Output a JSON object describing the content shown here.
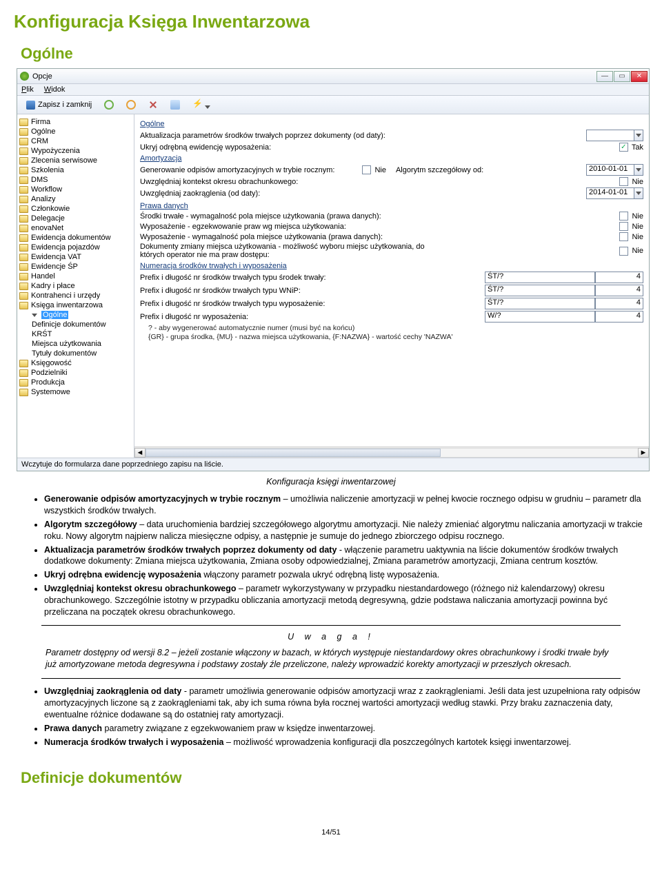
{
  "headings": {
    "h1": "Konfiguracja Księga Inwentarzowa",
    "h2": "Ogólne",
    "h3": "Definicje dokumentów"
  },
  "window": {
    "title": "Opcje",
    "menu_plik": "Plik",
    "menu_widok": "Widok",
    "save_close": "Zapisz i zamknij",
    "status": "Wczytuje do formularza dane poprzedniego zapisu na liście."
  },
  "tree": [
    "Firma",
    "Ogólne",
    "CRM",
    "Wypożyczenia",
    "Zlecenia serwisowe",
    "Szkolenia",
    "DMS",
    "Workflow",
    "Analizy",
    "Członkowie",
    "Delegacje",
    "enovaNet",
    "Ewidencja dokumentów",
    "Ewidencja pojazdów",
    "Ewidencja VAT",
    "Ewidencje ŚP",
    "Handel",
    "Kadry i płace",
    "Kontrahenci i urzędy",
    "Księga inwentarzowa"
  ],
  "tree_children": [
    "Ogólne",
    "Definicje dokumentów",
    "KRŚT",
    "Miejsca użytkowania",
    "Tytuły dokumentów"
  ],
  "tree_after": [
    "Księgowość",
    "Podzielniki",
    "Produkcja",
    "Systemowe"
  ],
  "form": {
    "sect_ogolne": "Ogólne",
    "r_upd": "Aktualizacja parametrów środków trwałych poprzez dokumenty (od daty):",
    "r_hide": "Ukryj odrębną ewidencję wyposażenia:",
    "r_hide_val": "Tak",
    "sect_amort": "Amortyzacja",
    "r_gen": "Generowanie odpisów amortyzacyjnych w trybie rocznym:",
    "r_gen_val": "Nie",
    "r_alg": "Algorytm szczegółowy od:",
    "r_alg_val": "2010-01-01",
    "r_ktx": "Uwzględniaj kontekst okresu obrachunkowego:",
    "r_ktx_val": "Nie",
    "r_round": "Uwzględniaj zaokrąglenia (od daty):",
    "r_round_val": "2014-01-01",
    "sect_prawa": "Prawa danych",
    "r_p1": "Środki trwałe - wymagalność pola miejsce użytkowania (prawa danych):",
    "r_p2": "Wyposażenie - egzekwowanie praw wg miejsca użytkowania:",
    "r_p3": "Wyposażenie - wymagalność pola miejsce użytkowania (prawa danych):",
    "r_p4": "Dokumenty zmiany miejsca użytkowania - możliwość wyboru miejsc użytkowania, do których operator nie ma praw dostępu:",
    "nie": "Nie",
    "sect_num": "Numeracja środków trwałych i wyposażenia",
    "r_n1": "Prefix i długość nr środków trwałych typu środek trwały:",
    "r_n2": "Prefix i długość nr środków trwałych typu WNiP:",
    "r_n3": "Prefix i długość nr środków trwałych typu wyposażenie:",
    "r_n4": "Prefix i długość nr wyposażenia:",
    "v_st": "ŚT/?",
    "v_w": "W/?",
    "v_len": "4",
    "hint1": "? - aby wygenerować automatycznie numer (musi być na końcu)",
    "hint2": "{GR} - grupa środka, {MU} - nazwa miejsca użytkowania, {F:NAZWA} - wartość cechy 'NAZWA'"
  },
  "caption": "Konfiguracja księgi inwentarzowej",
  "bul": {
    "b1a": "Generowanie odpisów amortyzacyjnych w trybie rocznym",
    "b1b": " – umożliwia naliczenie amortyzacji w pełnej kwocie rocznego odpisu w grudniu – parametr dla wszystkich środków trwałych.",
    "b2a": "Algorytm szczegółowy",
    "b2b": " – data uruchomienia bardziej szczegółowego algorytmu amortyzacji. Nie należy zmieniać algorytmu naliczania amortyzacji w trakcie roku. Nowy algorytm najpierw nalicza miesięczne odpisy, a następnie je sumuje do jednego zbiorczego odpisu rocznego.",
    "b3a": "Aktualizacja parametrów środków trwałych poprzez dokumenty od daty",
    "b3b": " - włączenie parametru uaktywnia na liście dokumentów środków trwałych dodatkowe dokumenty: Zmiana miejsca użytkowania, Zmiana osoby odpowiedzialnej, Zmiana parametrów amortyzacji, Zmiana centrum kosztów.",
    "b4a": "Ukryj odrębna ewidencję wyposażenia",
    "b4b": " włączony parametr pozwala ukryć odrębną listę wyposażenia.",
    "b5a": "Uwzględniaj kontekst okresu obrachunkowego",
    "b5b": " – parametr wykorzystywany w przypadku niestandardowego (różnego niż kalendarzowy) okresu obrachunkowego. Szczególnie istotny w przypadku obliczania amortyzacji metodą degresywną, gdzie podstawa naliczania amortyzacji powinna być przeliczana na początek okresu obrachunkowego."
  },
  "notice": {
    "title": "U w a g a !",
    "body": "Parametr dostępny od wersji 8.2 – jeżeli zostanie włączony w bazach, w których występuje niestandardowy okres obrachunkowy i środki trwałe były już amortyzowane metoda degresywna i podstawy zostały źle przeliczone, należy wprowadzić korekty amortyzacji w przeszłych okresach."
  },
  "bul2": {
    "b1a": "Uwzględniaj zaokrąglenia od daty",
    "b1b": " - parametr umożliwia generowanie odpisów amortyzacji wraz z zaokrągleniami. Jeśli data jest uzupełniona raty odpisów amortyzacyjnych liczone są z zaokrągleniami tak, aby ich suma równa była rocznej wartości amortyzacji według stawki. Przy braku zaznaczenia daty, ewentualne różnice dodawane są do ostatniej raty amortyzacji.",
    "b2a": "Prawa danych",
    "b2b": " parametry związane z egzekwowaniem praw w księdze inwentarzowej.",
    "b3a": "Numeracja środków trwałych i wyposażenia",
    "b3b": " – możliwość wprowadzenia konfiguracji dla poszczególnych kartotek księgi inwentarzowej."
  },
  "pagenum": "14/51"
}
